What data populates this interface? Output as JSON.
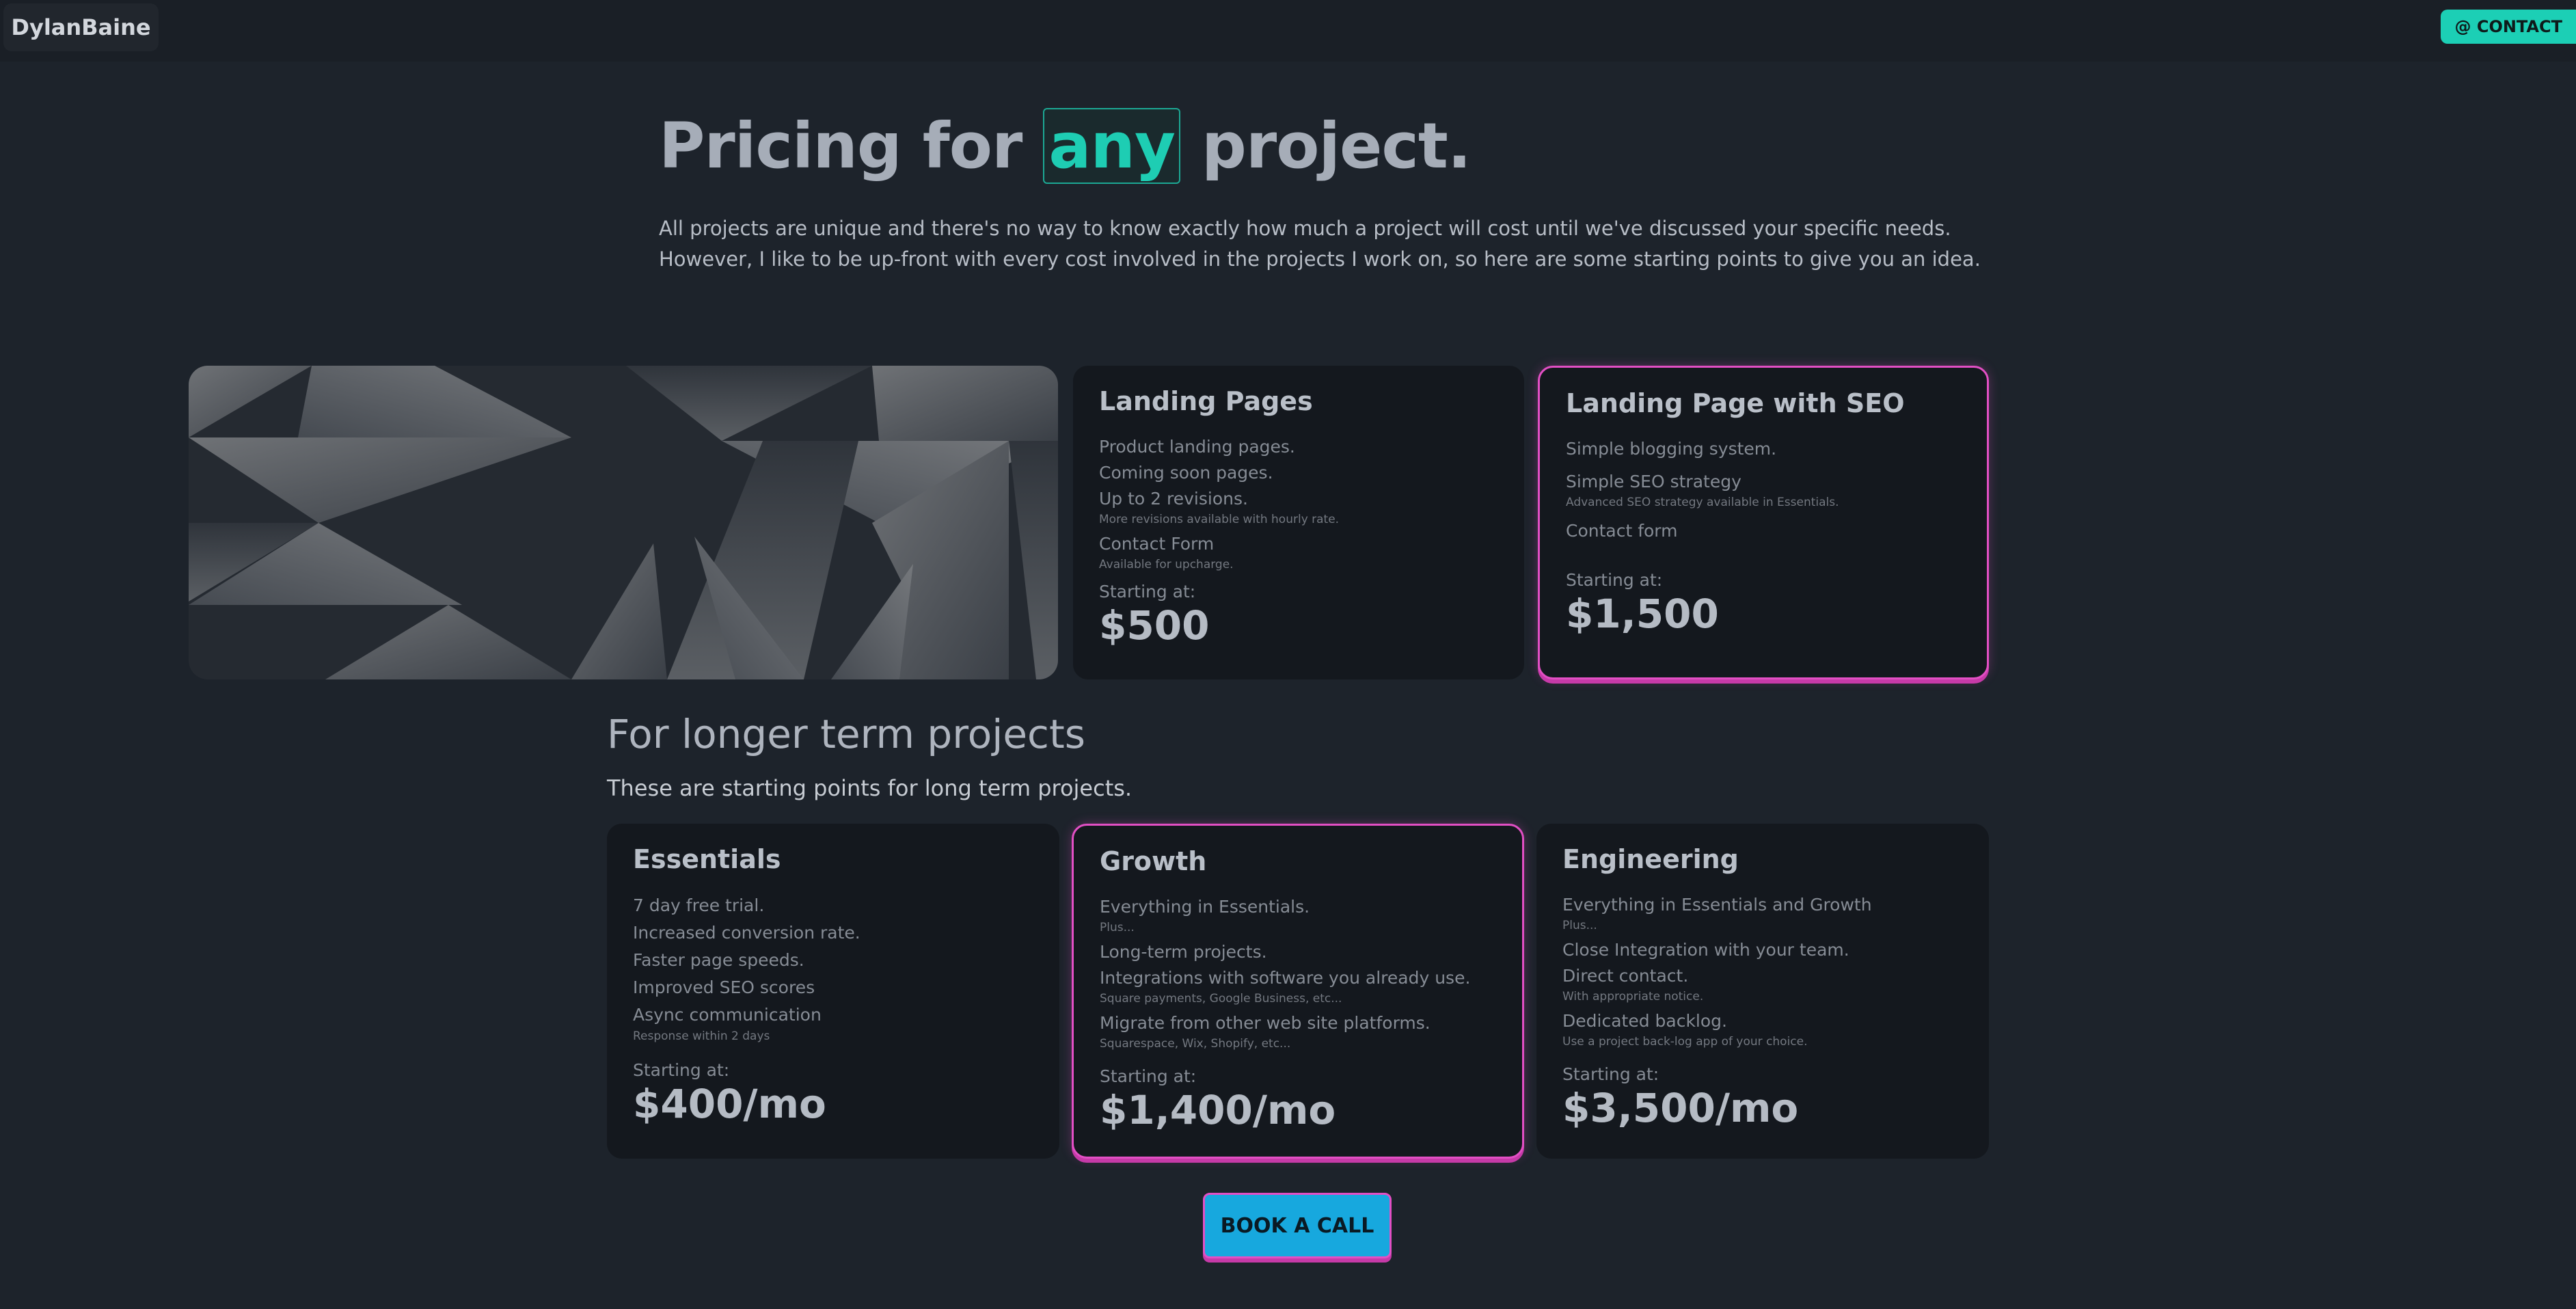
{
  "header": {
    "brand": "DylanBaine",
    "contact_label": "@ CONTACT"
  },
  "hero": {
    "title_before": "Pricing for",
    "title_highlight": "any",
    "title_after": "project.",
    "intro": "All projects are unique and there's no way to know exactly how much a project will cost until we've discussed your specific needs. However, I like to be up-front with every cost involved in the projects I work on, so here are some starting points to give you an idea."
  },
  "cards": {
    "landing": {
      "title": "Landing Pages",
      "features": [
        {
          "text": "Product landing pages."
        },
        {
          "text": "Coming soon pages."
        },
        {
          "text": "Up to 2 revisions.",
          "sub": "More revisions available with hourly rate."
        },
        {
          "text": "Contact Form",
          "sub": "Available for upcharge."
        }
      ],
      "starting_label": "Starting at:",
      "price": "$500"
    },
    "seo": {
      "title": "Landing Page with SEO",
      "features": [
        {
          "text": "Simple blogging system."
        },
        {
          "text": "Simple SEO strategy",
          "sub": "Advanced SEO strategy available in Essentials."
        },
        {
          "text": "Contact form"
        }
      ],
      "starting_label": "Starting at:",
      "price": "$1,500"
    },
    "essentials": {
      "title": "Essentials",
      "features": [
        {
          "text": "7 day free trial."
        },
        {
          "text": "Increased conversion rate."
        },
        {
          "text": "Faster page speeds."
        },
        {
          "text": "Improved SEO scores"
        },
        {
          "text": "Async communication",
          "sub": "Response within 2 days"
        }
      ],
      "starting_label": "Starting at:",
      "price": "$400/mo"
    },
    "growth": {
      "title": "Growth",
      "features": [
        {
          "text": "Everything in Essentials.",
          "sub": "Plus..."
        },
        {
          "text": "Long-term projects."
        },
        {
          "text": "Integrations with software you already use.",
          "sub": "Square payments, Google Business, etc..."
        },
        {
          "text": "Migrate from other web site platforms.",
          "sub": "Squarespace, Wix, Shopify, etc..."
        }
      ],
      "starting_label": "Starting at:",
      "price": "$1,400/mo"
    },
    "engineering": {
      "title": "Engineering",
      "features": [
        {
          "text": "Everything in Essentials and Growth",
          "sub": "Plus..."
        },
        {
          "text": "Close Integration with your team."
        },
        {
          "text": "Direct contact.",
          "sub": "With appropriate notice."
        },
        {
          "text": "Dedicated backlog.",
          "sub": "Use a project back-log app of your choice."
        }
      ],
      "starting_label": "Starting at:",
      "price": "$3,500/mo"
    }
  },
  "long_term": {
    "title": "For longer term projects",
    "subtitle": "These are starting points for long term projects."
  },
  "cta": {
    "label": "BOOK A CALL"
  },
  "colors": {
    "accent_teal": "#1ecdb3",
    "accent_pink": "#e24fc4",
    "cta_blue": "#17a8de"
  }
}
